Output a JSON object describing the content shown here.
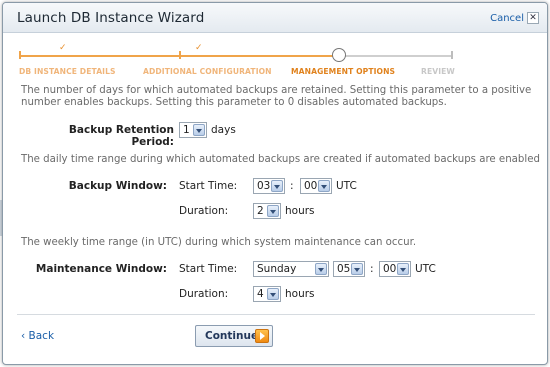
{
  "dialog": {
    "title": "Launch DB Instance Wizard",
    "cancel_label": "Cancel"
  },
  "steps": [
    {
      "label": "DB INSTANCE DETAILS",
      "status": "done"
    },
    {
      "label": "ADDITIONAL CONFIGURATION",
      "status": "done"
    },
    {
      "label": "MANAGEMENT OPTIONS",
      "status": "current"
    },
    {
      "label": "REVIEW",
      "status": "todo"
    }
  ],
  "step_check": "✓",
  "intro_text": "The number of days for which automated backups are retained. Setting this parameter to a positive number enables backups. Setting this parameter to 0 disables automated backups.",
  "backup_retention": {
    "label": "Backup Retention Period:",
    "value": "1",
    "unit": "days"
  },
  "backup_window": {
    "description": "The daily time range during which automated backups are created if automated backups are enabled",
    "label": "Backup Window:",
    "start_time_label": "Start Time:",
    "start_hour": "03",
    "separator": ":",
    "start_minute": "00",
    "timezone": "UTC",
    "duration_label": "Duration:",
    "duration_value": "2",
    "duration_unit": "hours"
  },
  "maintenance_window": {
    "description": "The weekly time range (in UTC) during which system maintenance can occur.",
    "label": "Maintenance Window:",
    "start_time_label": "Start Time:",
    "start_day": "Sunday",
    "start_hour": "05",
    "separator": ":",
    "start_minute": "00",
    "timezone": "UTC",
    "duration_label": "Duration:",
    "duration_value": "4",
    "duration_unit": "hours"
  },
  "footer": {
    "back_label": "‹ Back",
    "continue_label": "Continue"
  },
  "colors": {
    "accent_orange": "#f0a44a",
    "link_blue": "#1a5ea8"
  }
}
